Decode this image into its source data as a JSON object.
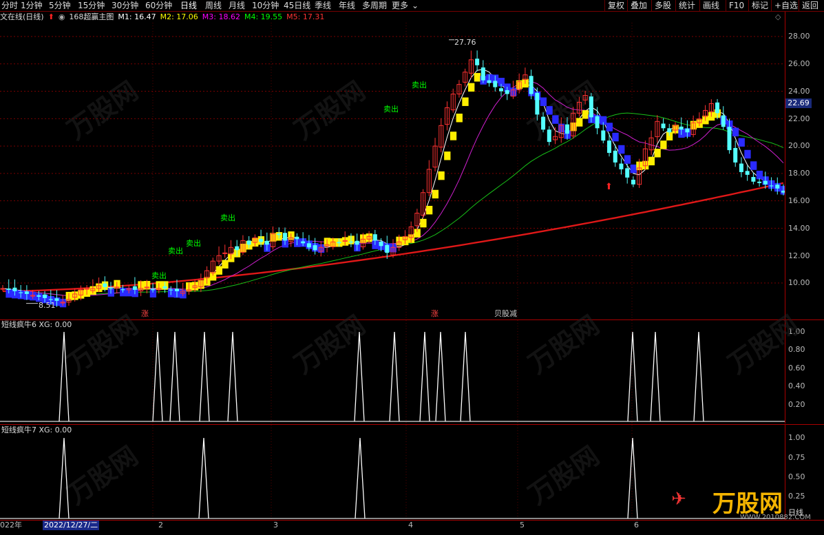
{
  "toolbar": {
    "periods": [
      "分时",
      "1分钟",
      "5分钟",
      "15分钟",
      "30分钟",
      "60分钟",
      "日线",
      "周线",
      "月线",
      "10分钟",
      "45日线",
      "季线",
      "年线",
      "多周期",
      "更多"
    ],
    "active_period": "日线",
    "right_tools": [
      "复权",
      "叠加",
      "多股",
      "统计",
      "画线",
      "F10",
      "标记",
      "+自选",
      "返回"
    ]
  },
  "infobar": {
    "title": "文在线(日线)",
    "indicator_name": "168超赢主图",
    "m1": "M1: 16.47",
    "m2": "M2: 17.06",
    "m3": "M3: 18.62",
    "m4": "M4: 19.55",
    "m5": "M5: 17.31",
    "colors": {
      "m1": "#ffffff",
      "m2": "#ffff00",
      "m3": "#ff00ff",
      "m4": "#00ff00",
      "m5": "#ff3030"
    }
  },
  "main_axis": {
    "ticks": [
      "28.00",
      "26.00",
      "24.00",
      "22.00",
      "20.00",
      "18.00",
      "16.00",
      "14.00",
      "12.00",
      "10.00"
    ],
    "current_price": "22.69"
  },
  "annotations": {
    "high_label": "27.76",
    "low_label": "8.51",
    "sell_label": "卖出",
    "event_labels": [
      "涨",
      "涨",
      "贝股减"
    ]
  },
  "sub1": {
    "label": "短线疯牛6 XG: 0.00",
    "ticks": [
      "1.00",
      "0.80",
      "0.60",
      "0.40",
      "0.20"
    ]
  },
  "sub2": {
    "label": "短线疯牛7 XG: 0.00",
    "ticks": [
      "1.00",
      "0.75",
      "0.50",
      "0.25"
    ],
    "axis_note": "日线"
  },
  "bottom": {
    "date_labels": [
      "022年",
      "2022/12/27/二",
      "2",
      "3",
      "4",
      "5",
      "6"
    ]
  },
  "watermark": {
    "brand": "万股网",
    "url": "WWW.2010882.COM"
  },
  "chart_data": {
    "type": "candlestick",
    "y_range": [
      8,
      29
    ],
    "close_series_approx": [
      9.6,
      9.5,
      9.4,
      9.3,
      9.2,
      9.1,
      9.0,
      8.9,
      8.8,
      8.7,
      8.6,
      8.8,
      9.2,
      9.5,
      9.6,
      9.6,
      9.8,
      9.7,
      9.6,
      9.7,
      9.5,
      9.6,
      9.5,
      9.6,
      9.7,
      9.5,
      9.6,
      9.6,
      9.5,
      9.4,
      9.4,
      9.5,
      9.8,
      10.3,
      10.9,
      11.6,
      12.0,
      12.2,
      12.6,
      12.4,
      13.1,
      12.8,
      13.3,
      13.0,
      12.8,
      13.6,
      13.5,
      13.1,
      13.3,
      13.2,
      12.9,
      12.6,
      12.4,
      12.6,
      12.8,
      13.0,
      12.9,
      13.1,
      13.0,
      12.8,
      13.2,
      13.4,
      13.1,
      12.7,
      12.2,
      12.6,
      13.0,
      13.4,
      14.1,
      15.1,
      16.6,
      18.3,
      20.0,
      21.5,
      22.8,
      23.8,
      24.5,
      25.4,
      26.3,
      25.9,
      24.8,
      24.6,
      24.3,
      24.0,
      23.8,
      24.1,
      24.7,
      25.2,
      23.8,
      22.3,
      21.2,
      20.3,
      20.7,
      21.5,
      20.9,
      22.4,
      23.2,
      23.7,
      22.1,
      21.3,
      20.4,
      19.5,
      18.8,
      18.3,
      17.7,
      17.2,
      18.4,
      19.8,
      20.6,
      21.8,
      21.3,
      21.0,
      21.5,
      21.2,
      21.0,
      21.7,
      22.0,
      22.6,
      23.1,
      22.4,
      21.4,
      19.7,
      18.8,
      18.1,
      17.9,
      17.4,
      17.3,
      17.2,
      17.1,
      16.9,
      16.6
    ]
  }
}
